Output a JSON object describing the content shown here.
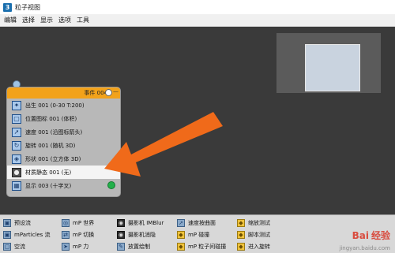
{
  "window": {
    "app_icon": "3",
    "title": "粒子视图"
  },
  "menu": [
    "编辑",
    "选择",
    "显示",
    "选项",
    "工具"
  ],
  "event": {
    "title": "事件 004",
    "operators": [
      {
        "icon": "birth-icon",
        "label": "出生 001 (0-30 T:200)"
      },
      {
        "icon": "position-icon",
        "label": "位置图标 001 (体积)"
      },
      {
        "icon": "speed-icon",
        "label": "速度 001 (沿图标箭头)"
      },
      {
        "icon": "spin-icon",
        "label": "旋转 001 (随机 3D)"
      },
      {
        "icon": "shape-icon",
        "label": "形状 001 (立方体 3D)"
      },
      {
        "icon": "material-icon",
        "label": "材质静态 001 (无)",
        "selected": true
      },
      {
        "icon": "display-icon",
        "label": "显示 003 (十字叉)"
      }
    ]
  },
  "depot": [
    {
      "icon": "preset-icon",
      "label": "预设流"
    },
    {
      "icon": "mparticles-icon",
      "label": "mParticles 流"
    },
    {
      "icon": "empty-icon",
      "label": "空流"
    },
    {
      "icon": "world-icon",
      "label": "mP 世界"
    },
    {
      "icon": "switch-icon",
      "label": "mP 切换"
    },
    {
      "icon": "force-icon",
      "label": "mP 力"
    },
    {
      "icon": "camera-imblur-icon",
      "label": "摄影机 IMBlur"
    },
    {
      "icon": "camera-cull-icon",
      "label": "摄影机消隐"
    },
    {
      "icon": "placement-paint-icon",
      "label": "放置绘制"
    },
    {
      "icon": "speed-surface-icon",
      "label": "速度按曲面"
    },
    {
      "icon": "mp-collision-icon",
      "label": "mP 碰撞"
    },
    {
      "icon": "mp-glue-icon",
      "label": "mP 粒子间碰撞"
    },
    {
      "icon": "scale-test-icon",
      "label": "缩放测试"
    },
    {
      "icon": "script-test-icon",
      "label": "脚本测试"
    },
    {
      "icon": "spin-test-icon",
      "label": "进入旋转"
    }
  ],
  "watermark": {
    "brand": "Bai",
    "brand2": "经验",
    "url": "jingyan.baidu.com"
  },
  "colors": {
    "event_header": "#f2a21a",
    "arrow": "#f06a1a",
    "display_dot": "#22b04a"
  }
}
